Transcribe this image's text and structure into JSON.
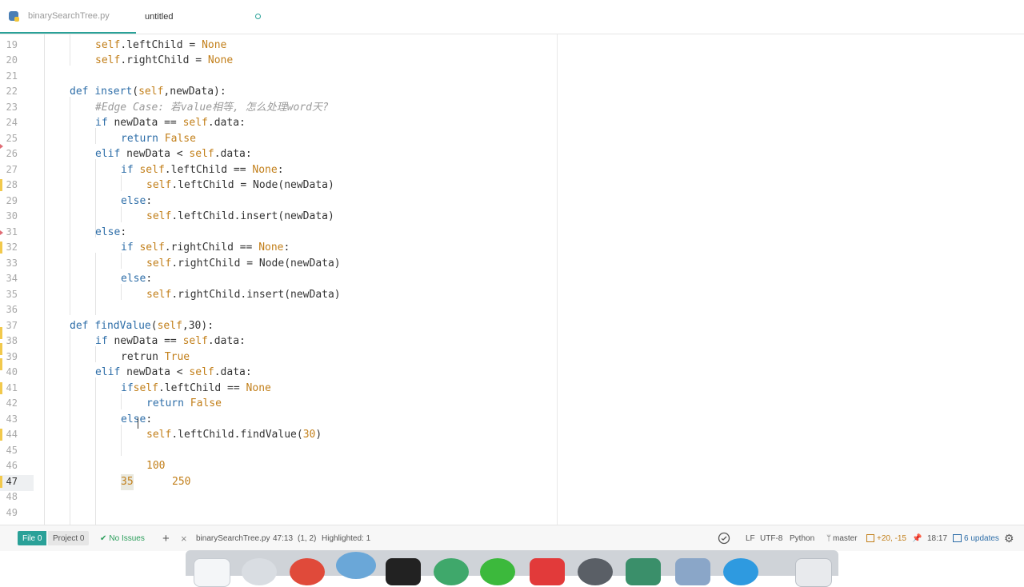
{
  "tabs": [
    {
      "label": "binarySearchTree.py",
      "active": true,
      "icon": "python-file-icon"
    },
    {
      "label": "untitled",
      "active": false,
      "modified": true
    }
  ],
  "editor": {
    "current_line": 47,
    "lines": [
      {
        "n": "19"
      },
      {
        "n": "20"
      },
      {
        "n": "21"
      },
      {
        "n": "22"
      },
      {
        "n": "23"
      },
      {
        "n": "24"
      },
      {
        "n": "25"
      },
      {
        "n": "26"
      },
      {
        "n": "27"
      },
      {
        "n": "28"
      },
      {
        "n": "29"
      },
      {
        "n": "30"
      },
      {
        "n": "31"
      },
      {
        "n": "32"
      },
      {
        "n": "33"
      },
      {
        "n": "34"
      },
      {
        "n": "35"
      },
      {
        "n": "36"
      },
      {
        "n": "37"
      },
      {
        "n": "38"
      },
      {
        "n": "39"
      },
      {
        "n": "40"
      },
      {
        "n": "41"
      },
      {
        "n": "42"
      },
      {
        "n": "43"
      },
      {
        "n": "44"
      },
      {
        "n": "45"
      },
      {
        "n": "46"
      },
      {
        "n": "47"
      },
      {
        "n": "48"
      },
      {
        "n": "49"
      }
    ],
    "code": {
      "l19": [
        "self",
        ".leftChild = ",
        "None"
      ],
      "l20": [
        "self",
        ".rightChild = ",
        "None"
      ],
      "l22": [
        "def ",
        "insert",
        "(",
        "self",
        ",newData):"
      ],
      "l23": "#Edge Case: 若value相等, 怎么处理word天?",
      "l24": [
        "if ",
        "newData == ",
        "self",
        ".data:"
      ],
      "l25": [
        "return ",
        "False"
      ],
      "l26": [
        "elif ",
        "newData < ",
        "self",
        ".data:"
      ],
      "l27": [
        "if ",
        "self",
        ".leftChild == ",
        "None",
        ":"
      ],
      "l28": [
        "self",
        ".leftChild = Node(newData)"
      ],
      "l29": [
        "else",
        ":"
      ],
      "l30": [
        "self",
        ".leftChild.insert(newData)"
      ],
      "l31": [
        "else",
        ":"
      ],
      "l32": [
        "if ",
        "self",
        ".rightChild == ",
        "None",
        ":"
      ],
      "l33": [
        "self",
        ".rightChild = Node(newData)"
      ],
      "l34": [
        "else",
        ":"
      ],
      "l35": [
        "self",
        ".rightChild.insert(newData)"
      ],
      "l37": [
        "def ",
        "findValue",
        "(",
        "self",
        ",",
        "30",
        "):"
      ],
      "l38": [
        "if ",
        "newData == ",
        "self",
        ".data:"
      ],
      "l39": [
        "retrun ",
        "True"
      ],
      "l40": [
        "elif ",
        "newData < ",
        "self",
        ".data:"
      ],
      "l41": [
        "if",
        "self",
        ".leftChild == ",
        "None"
      ],
      "l42": [
        "return ",
        "False"
      ],
      "l43": [
        "else",
        ":"
      ],
      "l44": [
        "self",
        ".leftChild.findValue(",
        "30",
        ")"
      ],
      "l46": "100",
      "l47a": "35",
      "l47b": "250"
    }
  },
  "statusbar": {
    "file_label": "File 0",
    "project_label": "Project 0",
    "issues": "No Issues",
    "add": "+",
    "close": "×",
    "filename": "binarySearchTree.py",
    "cursor_pos": "47:13",
    "selection": "(1, 2)",
    "highlighted": "Highlighted: 1",
    "line_ending": "LF",
    "encoding": "UTF-8",
    "grammar": "Python",
    "branch": "master",
    "diff": "+20, -15",
    "time": "18:17",
    "updates": "6 updates"
  },
  "colors": {
    "accent": "#2aa198",
    "keyword": "#2e6ea8",
    "self": "#c27f1a",
    "comment": "#9a9a9a"
  }
}
